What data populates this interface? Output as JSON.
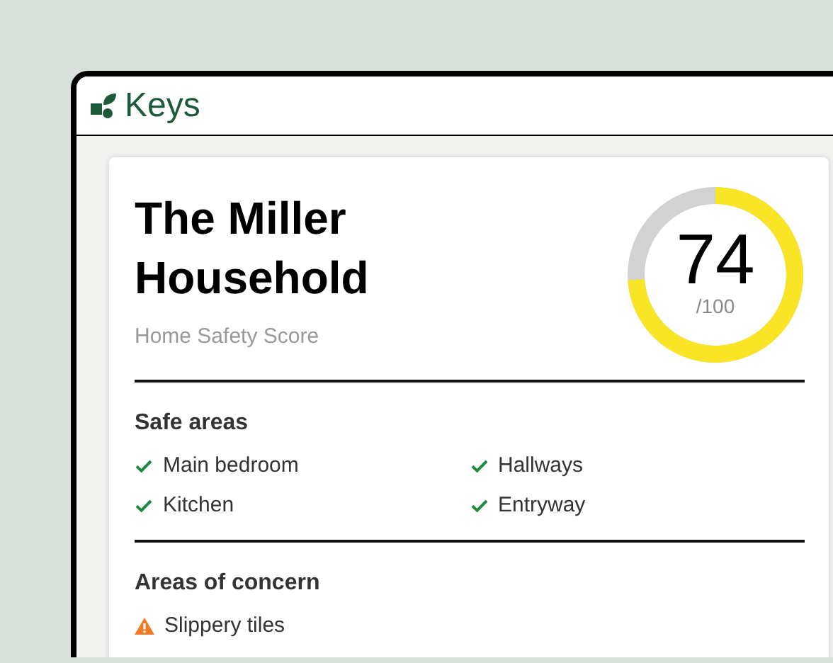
{
  "brand": {
    "name": "Keys"
  },
  "household": {
    "title": "The Miller Household",
    "subtitle": "Home Safety Score"
  },
  "score": {
    "value": "74",
    "out_of": "/100"
  },
  "sections": [
    {
      "heading": "Safe areas",
      "items": [
        {
          "label": "Main bedroom",
          "kind": "safe"
        },
        {
          "label": "Hallways",
          "kind": "safe"
        },
        {
          "label": "Kitchen",
          "kind": "safe"
        },
        {
          "label": "Entryway",
          "kind": "safe"
        }
      ]
    },
    {
      "heading": "Areas of concern",
      "items": [
        {
          "label": "Slippery tiles",
          "kind": "concern"
        }
      ]
    }
  ]
}
